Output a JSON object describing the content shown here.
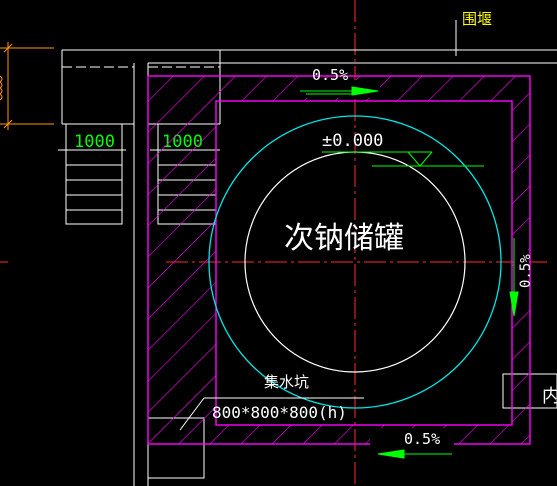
{
  "labels": {
    "wall": "围堰",
    "tank": "次钠储罐",
    "elevation": "±0.000",
    "slope_top": "0.5%",
    "slope_right": "0.5%",
    "slope_bottom": "0.5%",
    "sump_name": "集水坑",
    "sump_size": "800*800*800(h)",
    "stair_left_width": "1000",
    "stair_right_width": "1000",
    "edge_char": "内"
  },
  "colors": {
    "background": "#000000",
    "wall_lines": "#ffffff",
    "magenta": "#ff00ff",
    "cyan": "#00e5e5",
    "green": "#00ff00",
    "red_axis": "#ff2a2a",
    "yellow": "#ffff00",
    "orange_dim": "#ff9900"
  }
}
